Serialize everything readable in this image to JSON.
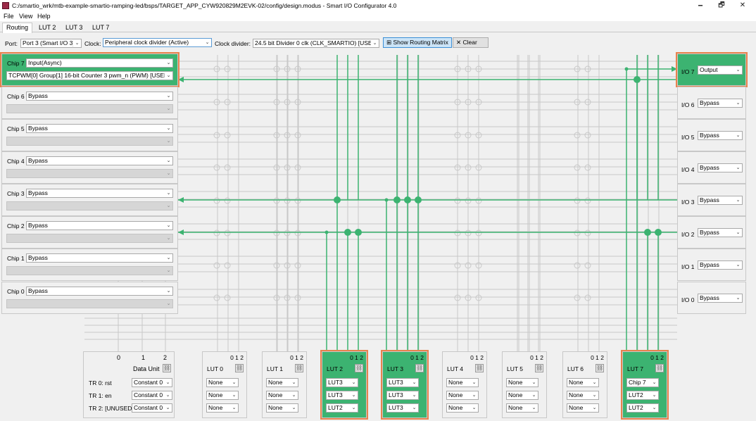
{
  "window": {
    "title": "C:/smartio_wrk/mtb-example-smartio-ramping-led/bsps/TARGET_APP_CYW920829M2EVK-02/config/design.modus - Smart I/O Configurator 4.0",
    "minimize": "🗕",
    "maximize": "🗗",
    "close": "✕"
  },
  "menu": [
    "File",
    "View",
    "Help"
  ],
  "tabs": [
    "Routing",
    "LUT 2",
    "LUT 3",
    "LUT 7"
  ],
  "toolbar": {
    "port_label": "Port:",
    "port_value": "Port 3 (Smart I/O 3)",
    "clock_label": "Clock:",
    "clock_value": "Peripheral clock divider (Active)",
    "divider_label": "Clock divider:",
    "divider_value": "24.5 bit Divider 0 clk (CLK_SMARTIO) [USED]",
    "show_matrix": "Show Routing Matrix",
    "clear": "Clear",
    "matrix_icon": "grid-icon",
    "clear_icon": "x-icon"
  },
  "chips": [
    {
      "label": "Chip 7",
      "mode": "Input(Async)",
      "signal": "TCPWM[0] Group[1] 16-bit Counter 3 pwm_n (PWM) [USED]"
    },
    {
      "label": "Chip 6",
      "mode": "Bypass",
      "signal": ""
    },
    {
      "label": "Chip 5",
      "mode": "Bypass",
      "signal": ""
    },
    {
      "label": "Chip 4",
      "mode": "Bypass",
      "signal": ""
    },
    {
      "label": "Chip 3",
      "mode": "Bypass",
      "signal": ""
    },
    {
      "label": "Chip 2",
      "mode": "Bypass",
      "signal": ""
    },
    {
      "label": "Chip 1",
      "mode": "Bypass",
      "signal": ""
    },
    {
      "label": "Chip 0",
      "mode": "Bypass",
      "signal": ""
    }
  ],
  "ios": [
    {
      "label": "I/O 7",
      "mode": "Output"
    },
    {
      "label": "I/O 6",
      "mode": "Bypass"
    },
    {
      "label": "I/O 5",
      "mode": "Bypass"
    },
    {
      "label": "I/O 4",
      "mode": "Bypass"
    },
    {
      "label": "I/O 3",
      "mode": "Bypass"
    },
    {
      "label": "I/O 2",
      "mode": "Bypass"
    },
    {
      "label": "I/O 1",
      "mode": "Bypass"
    },
    {
      "label": "I/O 0",
      "mode": "Bypass"
    }
  ],
  "data_unit": {
    "label": "Data Unit",
    "inputs": [
      "0",
      "1",
      "2"
    ],
    "rows": [
      {
        "label": "TR 0: rst",
        "value": "Constant 0"
      },
      {
        "label": "TR 1: en",
        "value": "Constant 0"
      },
      {
        "label": "TR 2: [UNUSED]",
        "value": "Constant 0"
      }
    ]
  },
  "luts": [
    {
      "name": "LUT 0",
      "inputs": [
        "None",
        "None",
        "None"
      ],
      "active": false
    },
    {
      "name": "LUT 1",
      "inputs": [
        "None",
        "None",
        "None"
      ],
      "active": false
    },
    {
      "name": "LUT 2",
      "inputs": [
        "LUT3",
        "LUT3",
        "LUT2"
      ],
      "active": true
    },
    {
      "name": "LUT 3",
      "inputs": [
        "LUT3",
        "LUT3",
        "LUT3"
      ],
      "active": true
    },
    {
      "name": "LUT 4",
      "inputs": [
        "None",
        "None",
        "None"
      ],
      "active": false
    },
    {
      "name": "LUT 5",
      "inputs": [
        "None",
        "None",
        "None"
      ],
      "active": false
    },
    {
      "name": "LUT 6",
      "inputs": [
        "None",
        "None",
        "None"
      ],
      "active": false
    },
    {
      "name": "LUT 7",
      "inputs": [
        "Chip 7",
        "LUT2",
        "LUT2"
      ],
      "active": true
    }
  ],
  "lut_input_nums": "0  1  2",
  "link_icon": "link-icon",
  "colors": {
    "active": "#3cb371",
    "highlight": "#e8834e",
    "wire": "#c8c8c8"
  }
}
